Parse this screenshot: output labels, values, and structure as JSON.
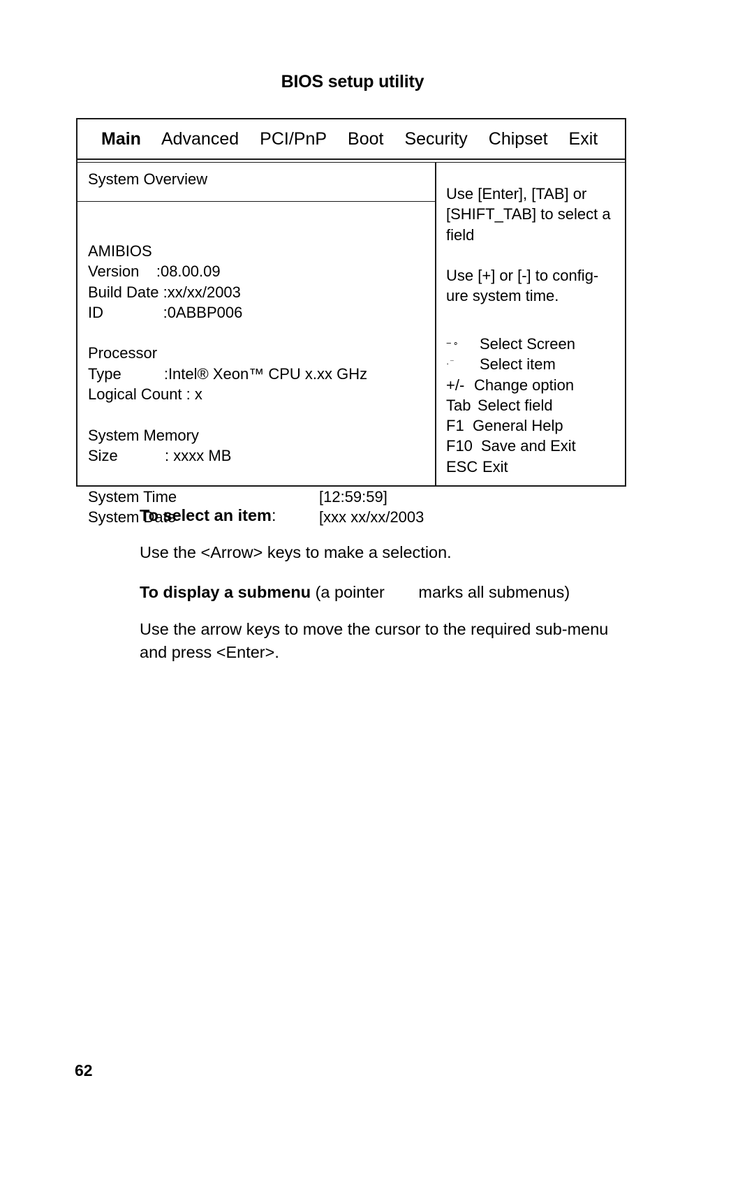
{
  "document": {
    "title": "BIOS setup utility",
    "page_number": "62"
  },
  "bios": {
    "tabs": [
      {
        "label": "Main",
        "active": true
      },
      {
        "label": "Advanced",
        "active": false
      },
      {
        "label": "PCI/PnP",
        "active": false
      },
      {
        "label": "Boot",
        "active": false
      },
      {
        "label": "Security",
        "active": false
      },
      {
        "label": "Chipset",
        "active": false
      },
      {
        "label": "Exit",
        "active": false
      }
    ],
    "left_panel": {
      "section_title": "System Overview",
      "groups": {
        "bios_heading": "AMIBIOS",
        "bios_rows": [
          {
            "key": "Version    ",
            "value": ":08.00.09"
          },
          {
            "key": "Build Date ",
            "value": ":xx/xx/2003"
          },
          {
            "key": "ID              ",
            "value": ":0ABBP006"
          }
        ],
        "processor_heading": "Processor",
        "processor_rows": [
          {
            "key": "Type          ",
            "value": ":Intel® Xeon™ CPU x.xx GHz"
          },
          {
            "key": "Logical Count : x",
            "value": ""
          }
        ],
        "memory_heading": "System Memory",
        "memory_rows": [
          {
            "key": "Size           ",
            "value": ": xxxx MB"
          }
        ],
        "datetime_rows": [
          {
            "key": "System Time",
            "value": "[12:59:59]"
          },
          {
            "key": "System Date",
            "value": "[xxx xx/xx/2003"
          }
        ]
      }
    },
    "right_panel": {
      "help_paragraphs": [
        "Use [Enter], [TAB] or [SHIFT_TAB] to select a field",
        "Use [+] or [-] to config-ure system time."
      ],
      "keys": [
        {
          "key": "←→",
          "glyph": true,
          "desc": "Select Screen"
        },
        {
          "key": "↑↓",
          "glyph": true,
          "desc": "Select item"
        },
        {
          "key": "+/-",
          "glyph": false,
          "desc": "Change option"
        },
        {
          "key": "Tab",
          "glyph": false,
          "desc": "Select field"
        },
        {
          "key": "F1",
          "glyph": false,
          "desc": "General Help"
        },
        {
          "key": "F10",
          "glyph": false,
          "desc": "Save and Exit"
        },
        {
          "key": "ESC",
          "glyph": false,
          "desc": "Exit"
        }
      ]
    }
  },
  "instructions": {
    "select_heading": "To select an item",
    "select_heading_suffix": ":",
    "select_body": "Use the <Arrow> keys to make a selection.",
    "submenu_heading": "To display a submenu",
    "submenu_rest_a": " (a pointer ",
    "submenu_rest_b": "marks all submenus)",
    "submenu_body": "Use the arrow keys to move the cursor to the required sub-menu and press <Enter>."
  }
}
